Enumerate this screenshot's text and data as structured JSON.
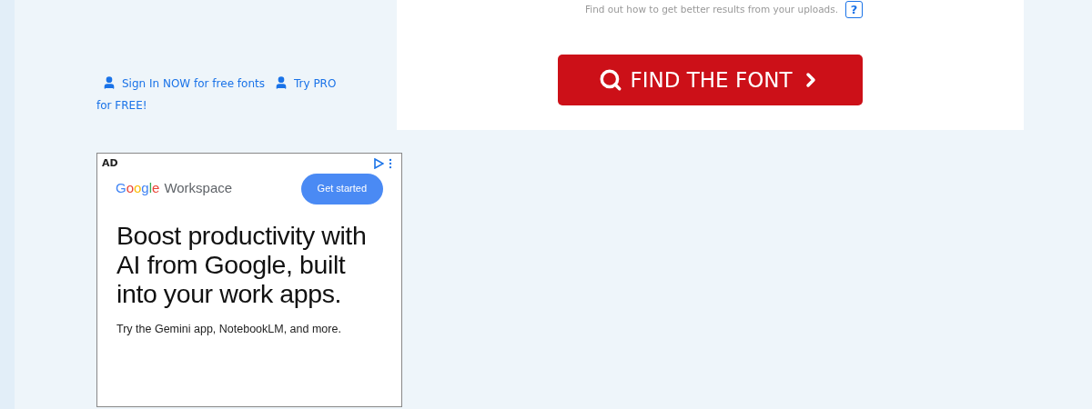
{
  "upload_panel": {
    "hint": "Find out how to get better results from your uploads.",
    "help_button": "?",
    "find_button": "FIND THE FONT"
  },
  "account_links": [
    {
      "label_lines": [
        "Sign In NOW for free fonts"
      ]
    },
    {
      "label_lines": [
        "Try PRO",
        "for FREE!"
      ]
    }
  ],
  "ad": {
    "badge": "AD",
    "logo": "Google",
    "product": "Workspace",
    "cta": "Get started",
    "headline": "Boost productivity with AI from Google, built into your work apps.",
    "subline": "Try the Gemini app, NotebookLM, and more."
  }
}
